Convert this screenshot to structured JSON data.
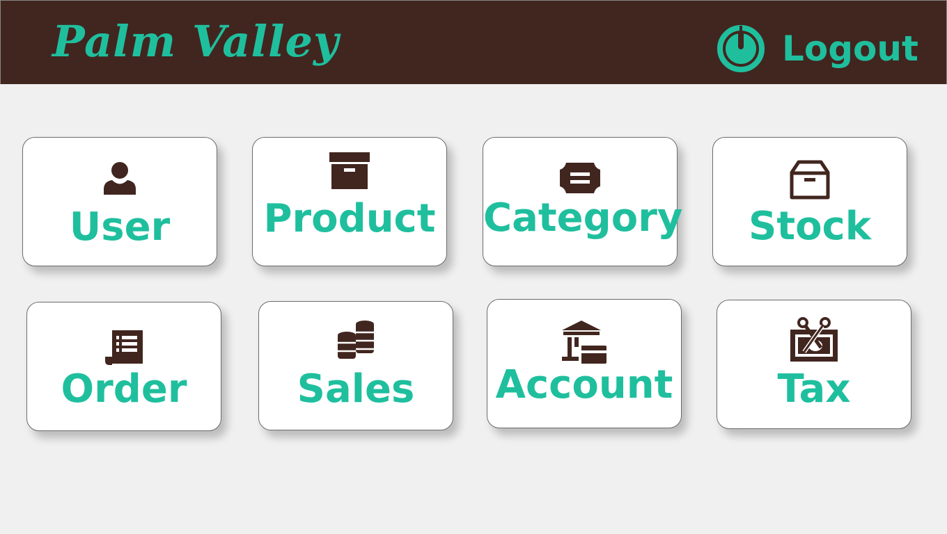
{
  "header": {
    "brand": "Palm Valley",
    "logout_label": "Logout",
    "logout_icon": "power-icon"
  },
  "colors": {
    "header_bg": "#41261f",
    "accent": "#1fbf9e",
    "icon": "#41261f",
    "page_bg": "#f0f0f0",
    "tile_bg": "#ffffff"
  },
  "tiles": [
    {
      "label": "User",
      "icon": "user-icon"
    },
    {
      "label": "Product",
      "icon": "archive-box-icon"
    },
    {
      "label": "Category",
      "icon": "ticket-icon"
    },
    {
      "label": "Stock",
      "icon": "box-icon"
    },
    {
      "label": "Order",
      "icon": "receipt-icon"
    },
    {
      "label": "Sales",
      "icon": "coins-icon"
    },
    {
      "label": "Account",
      "icon": "bank-card-icon"
    },
    {
      "label": "Tax",
      "icon": "money-scissors-icon"
    }
  ]
}
